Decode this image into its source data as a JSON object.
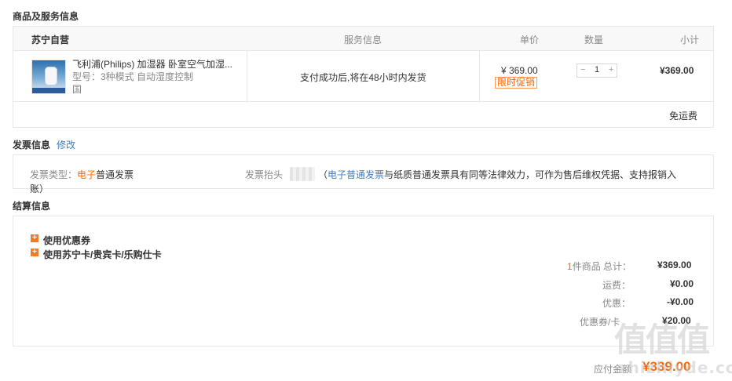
{
  "goods_section": {
    "title": "商品及服务信息",
    "header": {
      "store": "苏宁自营",
      "service": "服务信息",
      "price": "单价",
      "qty": "数量",
      "subtotal": "小计"
    },
    "item": {
      "name": "飞利浦(Philips) 加湿器 卧室空气加湿...",
      "model": "型号：3种模式 自动湿度控制",
      "model_cont": "国",
      "service_text": "支付成功后,将在48小时内发货",
      "price": "¥ 369.00",
      "promo_badge": "限时促销",
      "qty_minus": "−",
      "qty_value": "1",
      "qty_plus": "+",
      "subtotal": "¥369.00"
    },
    "shipping": "免运费"
  },
  "invoice_section": {
    "title": "发票信息",
    "edit_link": "修改",
    "type_label": "发票类型：",
    "type_value_hl": "电子",
    "type_value_rest": "普通发票",
    "type_value_wrap": "账）",
    "header_label": "发票抬头",
    "note_open": "（",
    "note_link": "电子普通发票",
    "note_rest": "与纸质普通发票具有同等法律效力，可作为售后维权凭据、支持报销入"
  },
  "settle_section": {
    "title": "结算信息",
    "options": [
      {
        "icon": "+",
        "label": "使用优惠券"
      },
      {
        "icon": "+",
        "label": "使用苏宁卡/贵宾卡/乐购仕卡"
      }
    ],
    "summary": {
      "count_num": "1",
      "count_text": "件商品 总计：",
      "total": "¥369.00",
      "freight_label": "运费：",
      "freight": "¥0.00",
      "discount_label": "优惠：",
      "discount": "-¥0.00",
      "coupon_label": "优惠券/卡",
      "coupon": "¥20.00"
    },
    "payable_label": "应付金额",
    "payable": "¥339.00"
  },
  "watermark": {
    "logo": "值值值",
    "site": "zhizhiyde.com"
  },
  "colors": {
    "accent": "#ff6600",
    "link": "#3f7cc2",
    "border": "#e8e8e8"
  }
}
